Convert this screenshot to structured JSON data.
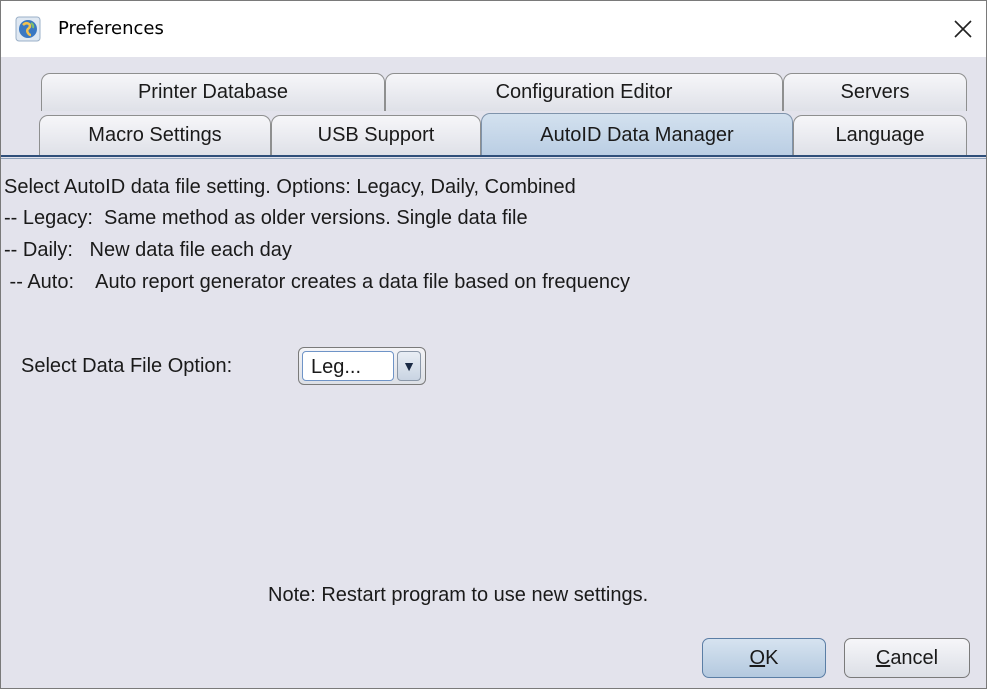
{
  "window": {
    "title": "Preferences",
    "icon": "app-globe-icon",
    "close_glyph": "✕"
  },
  "tabs": {
    "row_top": [
      {
        "label": "Printer Database"
      },
      {
        "label": "Configuration Editor"
      },
      {
        "label": "Servers"
      }
    ],
    "row_bottom": [
      {
        "label": "Macro Settings"
      },
      {
        "label": "USB Support"
      },
      {
        "label": "AutoID Data Manager",
        "selected": true
      },
      {
        "label": "Language"
      }
    ]
  },
  "content": {
    "lines": [
      "Select AutoID data file setting. Options: Legacy, Daily, Combined",
      "-- Legacy:  Same method as older versions. Single data file",
      "-- Daily:   New data file each day",
      " -- Auto:    Auto report generator creates a data file based on frequency"
    ],
    "select_label": "Select Data File Option:",
    "select_value": "Leg...",
    "select_arrow": "▼",
    "note": "Note: Restart program to use new settings."
  },
  "buttons": {
    "ok_mnemonic": "O",
    "ok_rest": "K",
    "cancel_mnemonic": "C",
    "cancel_rest": "ancel"
  },
  "colors": {
    "dialog_bg": "#e3e3ec",
    "selected_tab": "#c4d6ea",
    "accent_line": "#2f4f7a"
  }
}
